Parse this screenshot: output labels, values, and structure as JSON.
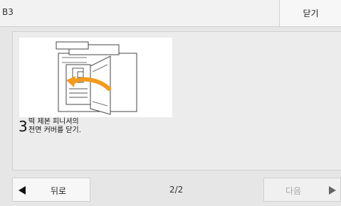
{
  "header": {
    "title": "B3",
    "close_label": "닫기"
  },
  "step": {
    "number": "3",
    "text_line1": "떡 제본 피니셔의",
    "text_line2": "전면 커버를 닫기.",
    "illustration": {
      "icon": "finisher-front-cover-close-illustration",
      "arrow_color": "#f39a1e"
    }
  },
  "footer": {
    "back_label": "뒤로",
    "page_indicator": "2/2",
    "next_label": "다음"
  }
}
